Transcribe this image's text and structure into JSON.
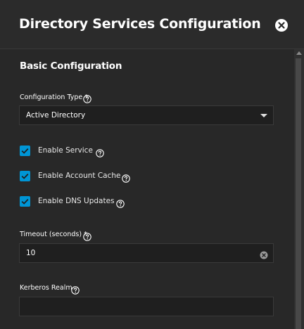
{
  "dialog": {
    "title": "Directory Services Configuration",
    "close_icon": "close-circle-icon"
  },
  "section": {
    "title": "Basic Configuration"
  },
  "configuration_type": {
    "label": "Configuration Type *",
    "value": "Active Directory",
    "help_icon": "help-circle-icon"
  },
  "checkboxes": [
    {
      "label": "Enable Service",
      "checked": true
    },
    {
      "label": "Enable Account Cache",
      "checked": true
    },
    {
      "label": "Enable DNS Updates",
      "checked": true
    }
  ],
  "timeout": {
    "label": "Timeout (seconds) *",
    "value": "10"
  },
  "kerberos_realm": {
    "label": "Kerberos Realm",
    "value": ""
  },
  "colors": {
    "background": "#282828",
    "accent": "#0095d5",
    "field_bg": "#1f1f1f"
  }
}
